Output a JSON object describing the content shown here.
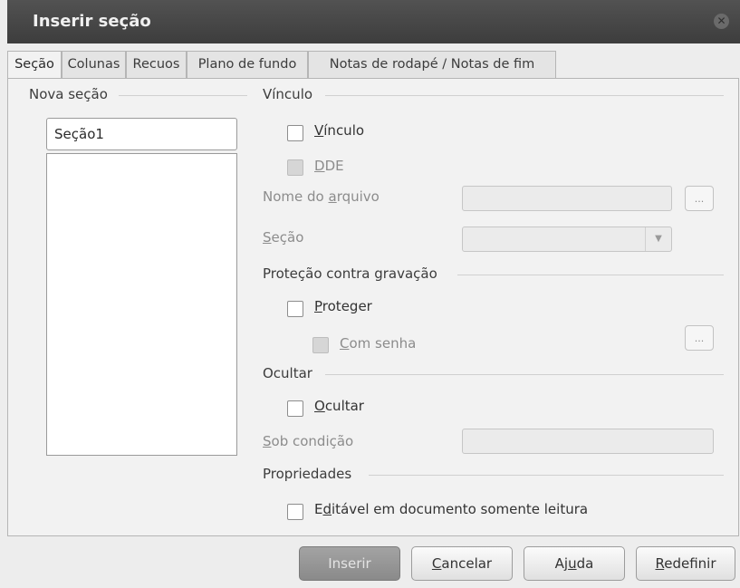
{
  "window": {
    "title": "Inserir seção"
  },
  "tabs": [
    {
      "label": "Seção",
      "active": true
    },
    {
      "label": "Colunas"
    },
    {
      "label": "Recuos"
    },
    {
      "label": "Plano de fundo"
    },
    {
      "label": "Notas de rodapé / Notas de fim"
    }
  ],
  "new_section": {
    "title": "Nova seção",
    "name_value": "Seção1"
  },
  "link": {
    "title": "Vínculo",
    "link_label_ul": "V",
    "link_label_rest": "ínculo",
    "dde_label_ul": "D",
    "dde_label_rest": "DE",
    "filename_label_pre": "Nome do ",
    "filename_label_ul": "a",
    "filename_label_post": "rquivo",
    "browse_label": "...",
    "section_label_ul": "S",
    "section_label_rest": "eção",
    "dropdown_arrow": "▼"
  },
  "protection": {
    "title": "Proteção contra gravação",
    "protect_label_ul": "P",
    "protect_label_rest": "roteger",
    "password_label_ul": "C",
    "password_label_rest": "om senha",
    "browse_label": "..."
  },
  "hide": {
    "title": "Ocultar",
    "hide_label_ul": "O",
    "hide_label_rest": "cultar",
    "condition_label_ul": "S",
    "condition_label_rest": "ob condição"
  },
  "properties": {
    "title": "Propriedades",
    "editable_label_pre": "E",
    "editable_label_ul": "d",
    "editable_label_rest": "itável em documento somente leitura"
  },
  "buttons": {
    "insert": "Inserir",
    "cancel_ul": "C",
    "cancel_rest": "ancelar",
    "help_pre": "Aj",
    "help_ul": "u",
    "help_rest": "da",
    "reset_ul": "R",
    "reset_rest": "edefinir"
  },
  "icons": {
    "close": "close-icon",
    "dropdown": "chevron-down-icon"
  }
}
